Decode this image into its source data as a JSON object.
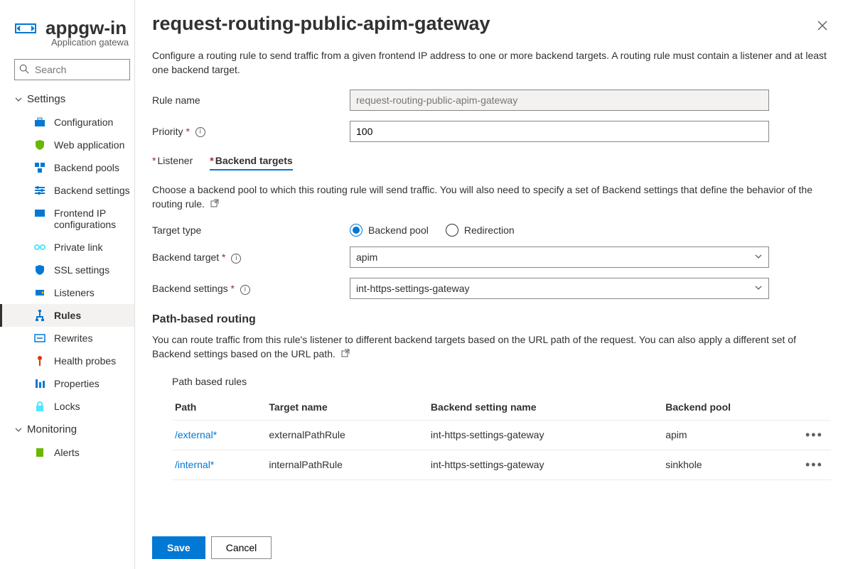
{
  "sidebar": {
    "title": "appgw-in",
    "subtitle": "Application gatewa",
    "search_placeholder": "Search",
    "sections": {
      "settings": "Settings",
      "monitoring": "Monitoring"
    },
    "nav": {
      "configuration": "Configuration",
      "waf": "Web application",
      "backend_pools": "Backend pools",
      "backend_settings": "Backend settings",
      "frontend_ip_l1": "Frontend IP",
      "frontend_ip_l2": "configurations",
      "private_link": "Private link",
      "ssl": "SSL settings",
      "listeners": "Listeners",
      "rules": "Rules",
      "rewrites": "Rewrites",
      "health": "Health probes",
      "properties": "Properties",
      "locks": "Locks",
      "alerts": "Alerts"
    }
  },
  "panel": {
    "title": "request-routing-public-apim-gateway",
    "description": "Configure a routing rule to send traffic from a given frontend IP address to one or more backend targets. A routing rule must contain a listener and at least one backend target.",
    "labels": {
      "rule_name": "Rule name",
      "priority": "Priority",
      "target_type": "Target type",
      "backend_target": "Backend target",
      "backend_settings": "Backend settings"
    },
    "values": {
      "rule_name": "request-routing-public-apim-gateway",
      "priority": "100",
      "backend_target": "apim",
      "backend_settings": "int-https-settings-gateway"
    },
    "tabs": {
      "listener": "Listener",
      "backend_targets": "Backend targets"
    },
    "backend_desc": "Choose a backend pool to which this routing rule will send traffic. You will also need to specify a set of Backend settings that define the behavior of the routing rule.",
    "radio": {
      "pool": "Backend pool",
      "redirect": "Redirection"
    },
    "path_routing": {
      "heading": "Path-based routing",
      "desc": "You can route traffic from this rule's listener to different backend targets based on the URL path of the request. You can also apply a different set of Backend settings based on the URL path."
    },
    "table": {
      "title": "Path based rules",
      "cols": {
        "path": "Path",
        "target": "Target name",
        "setting": "Backend setting name",
        "pool": "Backend pool"
      },
      "rows": [
        {
          "path": "/external*",
          "target": "externalPathRule",
          "setting": "int-https-settings-gateway",
          "pool": "apim"
        },
        {
          "path": "/internal*",
          "target": "internalPathRule",
          "setting": "int-https-settings-gateway",
          "pool": "sinkhole"
        }
      ]
    },
    "buttons": {
      "save": "Save",
      "cancel": "Cancel"
    }
  }
}
